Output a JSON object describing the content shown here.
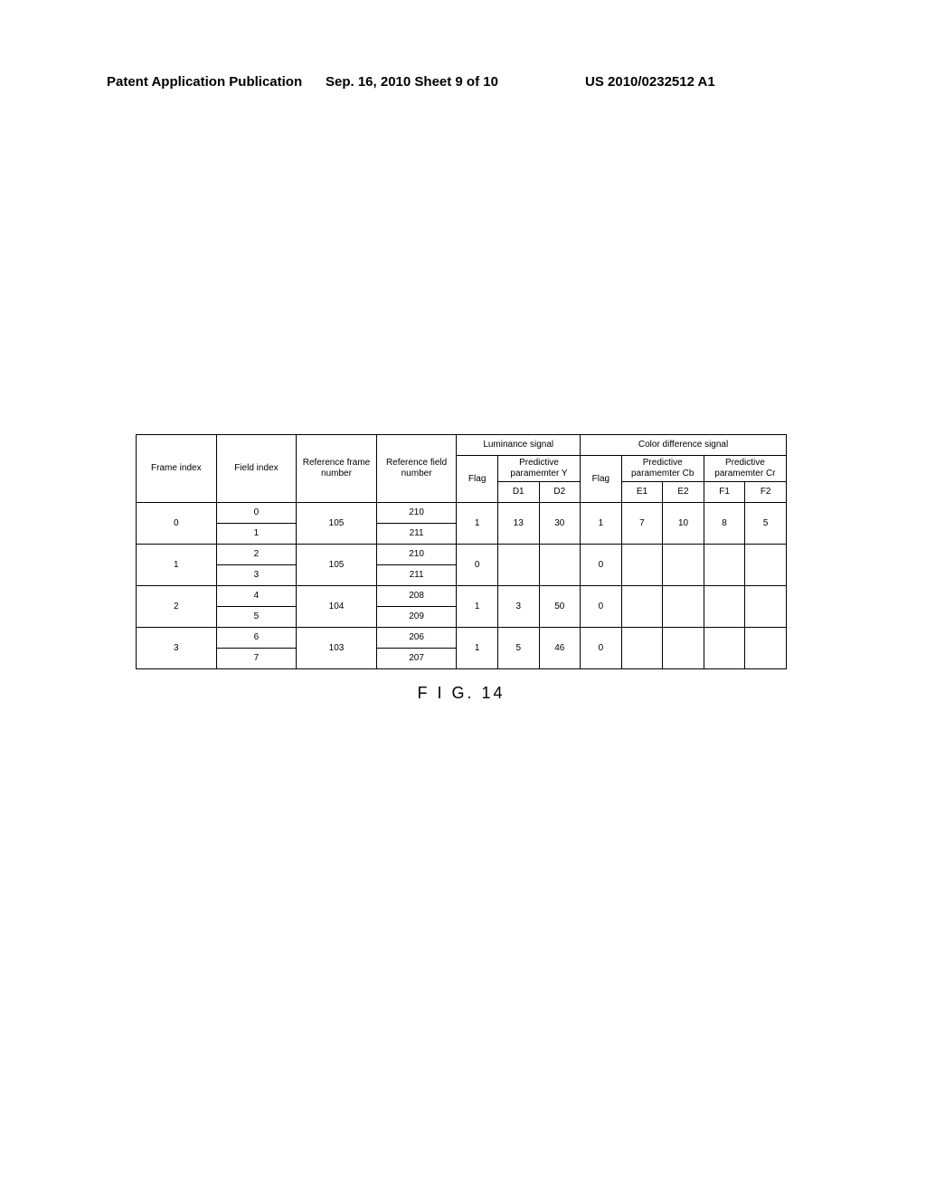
{
  "header": {
    "left": "Patent Application Publication",
    "center": "Sep. 16, 2010  Sheet 9 of 10",
    "right": "US 2010/0232512 A1"
  },
  "caption": "F I G. 14",
  "columns": {
    "frame_index": "Frame index",
    "field_index": "Field index",
    "ref_frame": "Reference frame number",
    "ref_field": "Reference field number",
    "lum_group": "Luminance signal",
    "cdiff_group": "Color difference signal",
    "flag": "Flag",
    "pred_y": "Predictive paramemter Y",
    "pred_cb": "Predictive paramemter Cb",
    "pred_cr": "Predictive paramemter Cr",
    "d1": "D1",
    "d2": "D2",
    "e1": "E1",
    "e2": "E2",
    "f1": "F1",
    "f2": "F2"
  },
  "chart_data": {
    "type": "table",
    "title": "FIG. 14",
    "rows": [
      {
        "frame_index": 0,
        "fields": [
          0,
          1
        ],
        "ref_frame": 105,
        "ref_fields": [
          210,
          211
        ],
        "lum": {
          "flag": 1,
          "d1": 13,
          "d2": 30
        },
        "cdiff": {
          "flag": 1,
          "e1": 7,
          "e2": 10,
          "f1": 8,
          "f2": 5
        }
      },
      {
        "frame_index": 1,
        "fields": [
          2,
          3
        ],
        "ref_frame": 105,
        "ref_fields": [
          210,
          211
        ],
        "lum": {
          "flag": 0,
          "d1": "",
          "d2": ""
        },
        "cdiff": {
          "flag": 0,
          "e1": "",
          "e2": "",
          "f1": "",
          "f2": ""
        }
      },
      {
        "frame_index": 2,
        "fields": [
          4,
          5
        ],
        "ref_frame": 104,
        "ref_fields": [
          208,
          209
        ],
        "lum": {
          "flag": 1,
          "d1": 3,
          "d2": 50
        },
        "cdiff": {
          "flag": 0,
          "e1": "",
          "e2": "",
          "f1": "",
          "f2": ""
        }
      },
      {
        "frame_index": 3,
        "fields": [
          6,
          7
        ],
        "ref_frame": 103,
        "ref_fields": [
          206,
          207
        ],
        "lum": {
          "flag": 1,
          "d1": 5,
          "d2": 46
        },
        "cdiff": {
          "flag": 0,
          "e1": "",
          "e2": "",
          "f1": "",
          "f2": ""
        }
      }
    ]
  }
}
